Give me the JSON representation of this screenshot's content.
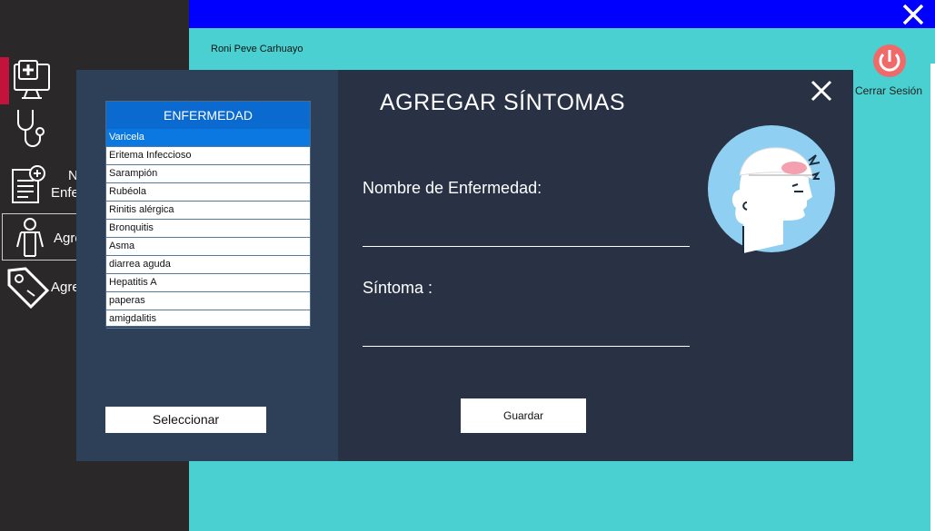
{
  "header": {
    "user_name": "Roni Peve Carhuayo",
    "logout_label": "Cerrar Sesión"
  },
  "sidebar": {
    "items": [
      {
        "icon": "medical-monitor-icon",
        "label": ""
      },
      {
        "icon": "stethoscope-icon",
        "label": ""
      },
      {
        "icon": "document-add-icon",
        "label": "N\nEnfe"
      },
      {
        "icon": "body-icon",
        "label": "Agre"
      },
      {
        "icon": "tag-icon",
        "label": "Agre"
      }
    ]
  },
  "modal": {
    "title": "AGREGAR SÍNTOMAS",
    "list": {
      "header": "ENFERMEDAD",
      "selected_index": 0,
      "items": [
        "Varicela",
        "Eritema Infeccioso",
        "Sarampión",
        "Rubéola",
        "Rinitis alérgica",
        "Bronquitis",
        "Asma",
        "diarrea aguda",
        "Hepatitis A",
        "paperas",
        "amigdalitis"
      ]
    },
    "select_button": "Seleccionar",
    "disease_label": "Nombre de Enfermedad:",
    "disease_value": "",
    "symptom_label": "Síntoma :",
    "symptom_value": "",
    "save_button": "Guardar"
  },
  "colors": {
    "topbar": "#0000ff",
    "main_bg": "#4ad0d0",
    "sidebar_bg": "#2b2829",
    "modal_bg": "#283244",
    "modal_left_bg": "#2d4058",
    "list_header": "#0a6ad0",
    "selected_row": "#0a78e0",
    "accent": "#c0143c"
  }
}
